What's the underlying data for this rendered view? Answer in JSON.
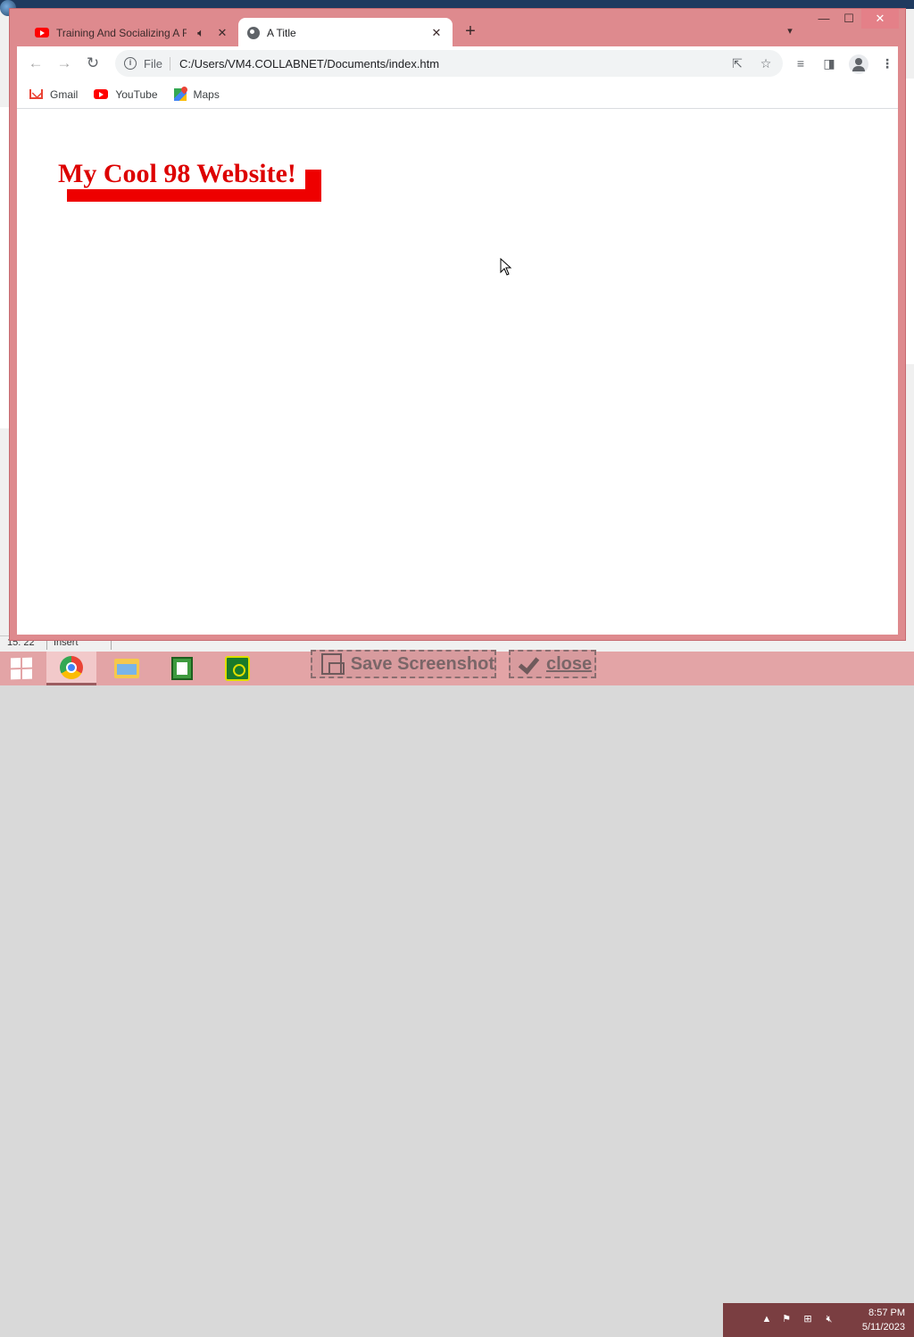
{
  "colors": {
    "window_frame": "#de8a8e",
    "heading": "#dd0000",
    "heading_shadow": "#ee0000",
    "taskbar": "#e3a4a6",
    "tray": "#7a3e41"
  },
  "background_app": {
    "status_position": "15: 22",
    "status_mode": "Insert"
  },
  "browser": {
    "tabs": [
      {
        "title": "Training And Socializing A Fe",
        "favicon": "youtube-icon",
        "audio_icon": "speaker-icon",
        "active": false
      },
      {
        "title": "A Title",
        "favicon": "globe-icon",
        "active": true
      }
    ],
    "new_tab_label": "+",
    "address_bar": {
      "scheme_chip": "File",
      "url": "C:/Users/VM4.COLLABNET/Documents/index.htm"
    },
    "bookmarks": [
      {
        "label": "Gmail",
        "icon": "gmail-icon"
      },
      {
        "label": "YouTube",
        "icon": "youtube-icon"
      },
      {
        "label": "Maps",
        "icon": "maps-icon"
      }
    ]
  },
  "page": {
    "heading": "My Cool 98 Website!"
  },
  "taskbar": {
    "apps": [
      "chrome-icon",
      "file-explorer-icon",
      "notepad-icon",
      "app-icon"
    ],
    "save_screenshot_label": "Save Screenshot",
    "close_label": "close",
    "clock_time": "8:57 PM",
    "clock_date": "5/11/2023"
  }
}
